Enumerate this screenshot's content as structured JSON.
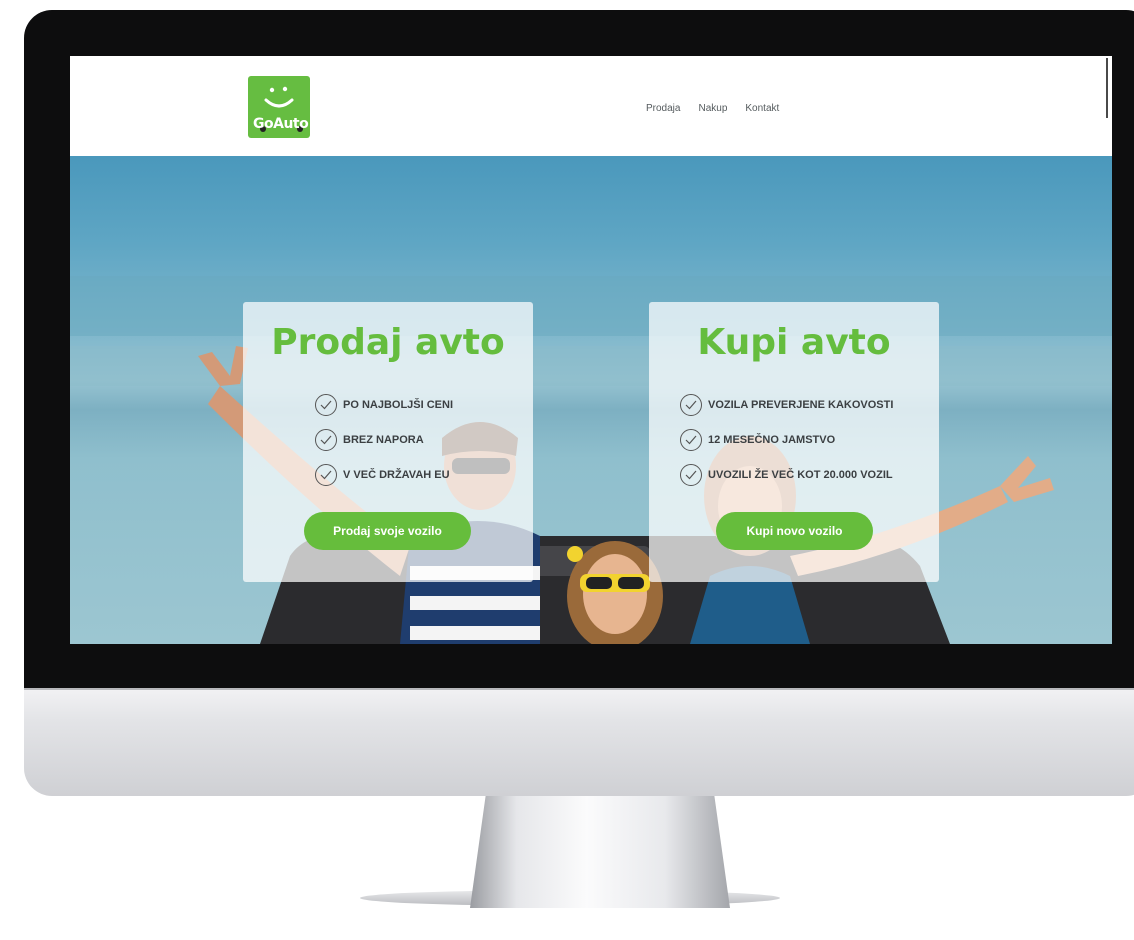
{
  "logo": {
    "text": "GoAuto"
  },
  "nav": {
    "items": [
      "Prodaja",
      "Nakup",
      "Kontakt"
    ]
  },
  "sell_card": {
    "title": "Prodaj avto",
    "features": [
      "PO NAJBOLJŠI CENI",
      "BREZ NAPORA",
      "V VEČ DRŽAVAH EU"
    ],
    "button": "Prodaj svoje vozilo"
  },
  "buy_card": {
    "title": "Kupi avto",
    "features": [
      "VOZILA PREVERJENE KAKOVOSTI",
      "12 MESEČNO JAMSTVO",
      "UVOZILI ŽE VEČ KOT 20.000 VOZIL"
    ],
    "button": "Kupi novo vozilo"
  },
  "colors": {
    "brand_green": "#66bd3c",
    "bezel": "#0d0d0e"
  }
}
